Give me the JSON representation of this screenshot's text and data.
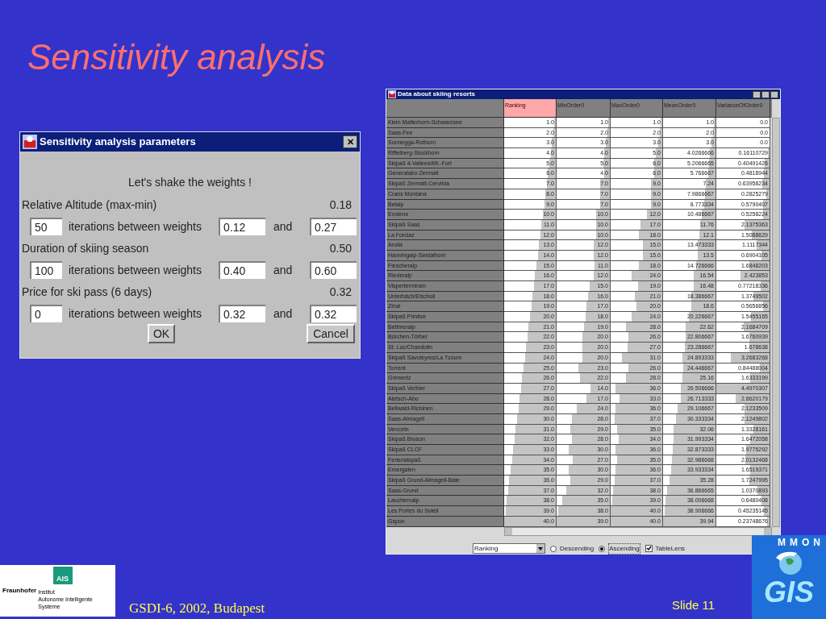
{
  "slide": {
    "title": "Sensitivity analysis",
    "footer": "GSDI-6, 2002, Budapest",
    "slide_number": "Slide 11"
  },
  "logos": {
    "institute": {
      "badge": "AIS",
      "name": "Fraunhofer",
      "lines": [
        "Institut",
        "Autonome Intelligente",
        "Systeme"
      ]
    },
    "project": {
      "top_text": "MMON",
      "main_text": "GIS"
    }
  },
  "dialog": {
    "title": "Sensitivity analysis parameters",
    "close": "✕",
    "heading": "Let's shake the weights !",
    "criteria": [
      {
        "name": "Relative Altitude (max-min)",
        "weight": "0.18",
        "iterations": "50",
        "middle_label": "iterations between weights",
        "from": "0.12",
        "and_label": "and",
        "to": "0.27"
      },
      {
        "name": "Duration of skiing season",
        "weight": "0.50",
        "iterations": "100",
        "middle_label": "iterations between weights",
        "from": "0.40",
        "and_label": "and",
        "to": "0.60"
      },
      {
        "name": "Price for ski pass (6 days)",
        "weight": "0.32",
        "iterations": "0",
        "middle_label": "iterations between weights",
        "from": "0.32",
        "and_label": "and",
        "to": "0.32"
      }
    ],
    "buttons": [
      "OK",
      "Cancel"
    ]
  },
  "table_window": {
    "title": "Data about skiing resorts",
    "columns": [
      {
        "label": "Ranking",
        "selected": true
      },
      {
        "label": "MinOrder0",
        "selected": false
      },
      {
        "label": "MaxOrder0",
        "selected": false
      },
      {
        "label": "MeanOrder0",
        "selected": false
      },
      {
        "label": "VarianceOfOrder0",
        "selected": false
      }
    ],
    "rows": [
      {
        "name": "Klein Matterhorn-Schwarzsee",
        "cells": [
          "1.0",
          "1.0",
          "1.0",
          "1.0",
          "0.0"
        ]
      },
      {
        "name": "Saas-Fee",
        "cells": [
          "2.0",
          "2.0",
          "2.0",
          "2.0",
          "0.0"
        ]
      },
      {
        "name": "Sunnegga-Rothorn",
        "cells": [
          "3.0",
          "3.0",
          "3.0",
          "3.0",
          "0.0"
        ]
      },
      {
        "name": "Riffelberg-Stockhorn",
        "cells": [
          "4.0",
          "4.0",
          "5.0",
          "4.0266666",
          "0.16110729"
        ]
      },
      {
        "name": "Skipaß 4-Vallees/Mt.-Fort",
        "cells": [
          "5.0",
          "5.0",
          "6.0",
          "5.2066665",
          "0.40491426"
        ]
      },
      {
        "name": "Generalabo Zermatt",
        "cells": [
          "6.0",
          "4.0",
          "6.0",
          "5.766667",
          "0.4818944"
        ]
      },
      {
        "name": "Skipaß Zermatt-Cervinia",
        "cells": [
          "7.0",
          "7.0",
          "9.0",
          "7.24",
          "0.63958234"
        ]
      },
      {
        "name": "Crans Montana",
        "cells": [
          "8.0",
          "7.0",
          "9.0",
          "7.9866667",
          "0.2825279"
        ]
      },
      {
        "name": "Belalp",
        "cells": [
          "9.0",
          "7.0",
          "9.0",
          "8.773334",
          "0.5790407"
        ]
      },
      {
        "name": "Evolene",
        "cells": [
          "10.0",
          "10.0",
          "12.0",
          "10.486667",
          "0.5258224"
        ]
      },
      {
        "name": "Skipaß Saas",
        "cells": [
          "11.0",
          "10.0",
          "17.0",
          "11.76",
          "2.1375363"
        ]
      },
      {
        "name": "La Forclaz",
        "cells": [
          "12.0",
          "10.0",
          "18.0",
          "12.1",
          "1.5088629"
        ]
      },
      {
        "name": "Arolla",
        "cells": [
          "13.0",
          "12.0",
          "15.0",
          "13.473333",
          "1.1117344"
        ]
      },
      {
        "name": "Hanningalp-Seetalhorn",
        "cells": [
          "14.0",
          "12.0",
          "15.0",
          "13.5",
          "0.6904105"
        ]
      },
      {
        "name": "Fiescheralp",
        "cells": [
          "15.0",
          "11.0",
          "18.0",
          "14.726666",
          "1.6848203"
        ]
      },
      {
        "name": "Riederalp",
        "cells": [
          "16.0",
          "12.0",
          "24.0",
          "16.54",
          "2.423853"
        ]
      },
      {
        "name": "Visperterminen",
        "cells": [
          "17.0",
          "15.0",
          "19.0",
          "16.48",
          "0.77218336"
        ]
      },
      {
        "name": "Unterbäch/Eischoll",
        "cells": [
          "18.0",
          "16.0",
          "21.0",
          "18.386667",
          "1.3749502"
        ]
      },
      {
        "name": "Zinal",
        "cells": [
          "19.0",
          "17.0",
          "20.0",
          "18.6",
          "0.5656856"
        ]
      },
      {
        "name": "Skipaß Prinitze",
        "cells": [
          "20.0",
          "18.0",
          "24.0",
          "20.226667",
          "1.5455165"
        ]
      },
      {
        "name": "Bettmeralp",
        "cells": [
          "21.0",
          "19.0",
          "28.0",
          "22.62",
          "2.1684709"
        ]
      },
      {
        "name": "Bürchen-Törbel",
        "cells": [
          "22.0",
          "20.0",
          "26.0",
          "22.806667",
          "1.6760939"
        ]
      },
      {
        "name": "St. Luc/Chandolin",
        "cells": [
          "23.0",
          "20.0",
          "27.0",
          "23.286667",
          "1.678638"
        ]
      },
      {
        "name": "Skipaß Savoleyres/La Tzoum",
        "cells": [
          "24.0",
          "20.0",
          "31.0",
          "24.893333",
          "3.2683268"
        ]
      },
      {
        "name": "Torrent",
        "cells": [
          "25.0",
          "23.0",
          "26.0",
          "24.446667",
          "0.84488004"
        ]
      },
      {
        "name": "Grimentz",
        "cells": [
          "26.0",
          "22.0",
          "28.0",
          "25.16",
          "1.6333199"
        ]
      },
      {
        "name": "Skipaß Verbier",
        "cells": [
          "27.0",
          "14.0",
          "36.0",
          "26.506666",
          "4.4970307"
        ]
      },
      {
        "name": "Aletsch-Abo",
        "cells": [
          "28.0",
          "17.0",
          "33.0",
          "26.713333",
          "2.8620179"
        ]
      },
      {
        "name": "Bellwald-Richinen",
        "cells": [
          "29.0",
          "24.0",
          "36.0",
          "29.106667",
          "2.1233509"
        ]
      },
      {
        "name": "Saas-Almagell",
        "cells": [
          "30.0",
          "28.0",
          "37.0",
          "30.333334",
          "2.1249802"
        ]
      },
      {
        "name": "Vercorin",
        "cells": [
          "31.0",
          "29.0",
          "35.0",
          "32.06",
          "1.3328161"
        ]
      },
      {
        "name": "Skipaß Bruson",
        "cells": [
          "32.0",
          "28.0",
          "34.0",
          "31.993334",
          "1.6472058"
        ]
      },
      {
        "name": "Skipaß CLCF",
        "cells": [
          "33.0",
          "30.0",
          "36.0",
          "32.873333",
          "1.9775292"
        ]
      },
      {
        "name": "Ferienskipaß",
        "cells": [
          "34.0",
          "27.0",
          "35.0",
          "32.986668",
          "2.0132468"
        ]
      },
      {
        "name": "Emergalen",
        "cells": [
          "35.0",
          "30.0",
          "36.0",
          "33.933334",
          "1.6519371"
        ]
      },
      {
        "name": "Skipaß Grund-Almagell-Bale",
        "cells": [
          "36.0",
          "29.0",
          "37.0",
          "35.28",
          "1.7247995"
        ]
      },
      {
        "name": "Saas-Grund",
        "cells": [
          "37.0",
          "32.0",
          "38.0",
          "36.866665",
          "1.0370893"
        ]
      },
      {
        "name": "Lauchernalp",
        "cells": [
          "38.0",
          "35.0",
          "39.0",
          "38.006668",
          "0.6480408"
        ]
      },
      {
        "name": "Les Portes du Soleil",
        "cells": [
          "39.0",
          "38.0",
          "40.0",
          "38.906666",
          "0.45235145"
        ]
      },
      {
        "name": "Gspon",
        "cells": [
          "40.0",
          "39.0",
          "40.0",
          "39.94",
          "0.23748676"
        ]
      }
    ],
    "sort_field": "Ranking",
    "order_options": [
      {
        "label": "Descending",
        "selected": false
      },
      {
        "label": "Ascending",
        "selected": true
      }
    ],
    "lens_option": {
      "label": "TableLens",
      "checked": true
    }
  }
}
